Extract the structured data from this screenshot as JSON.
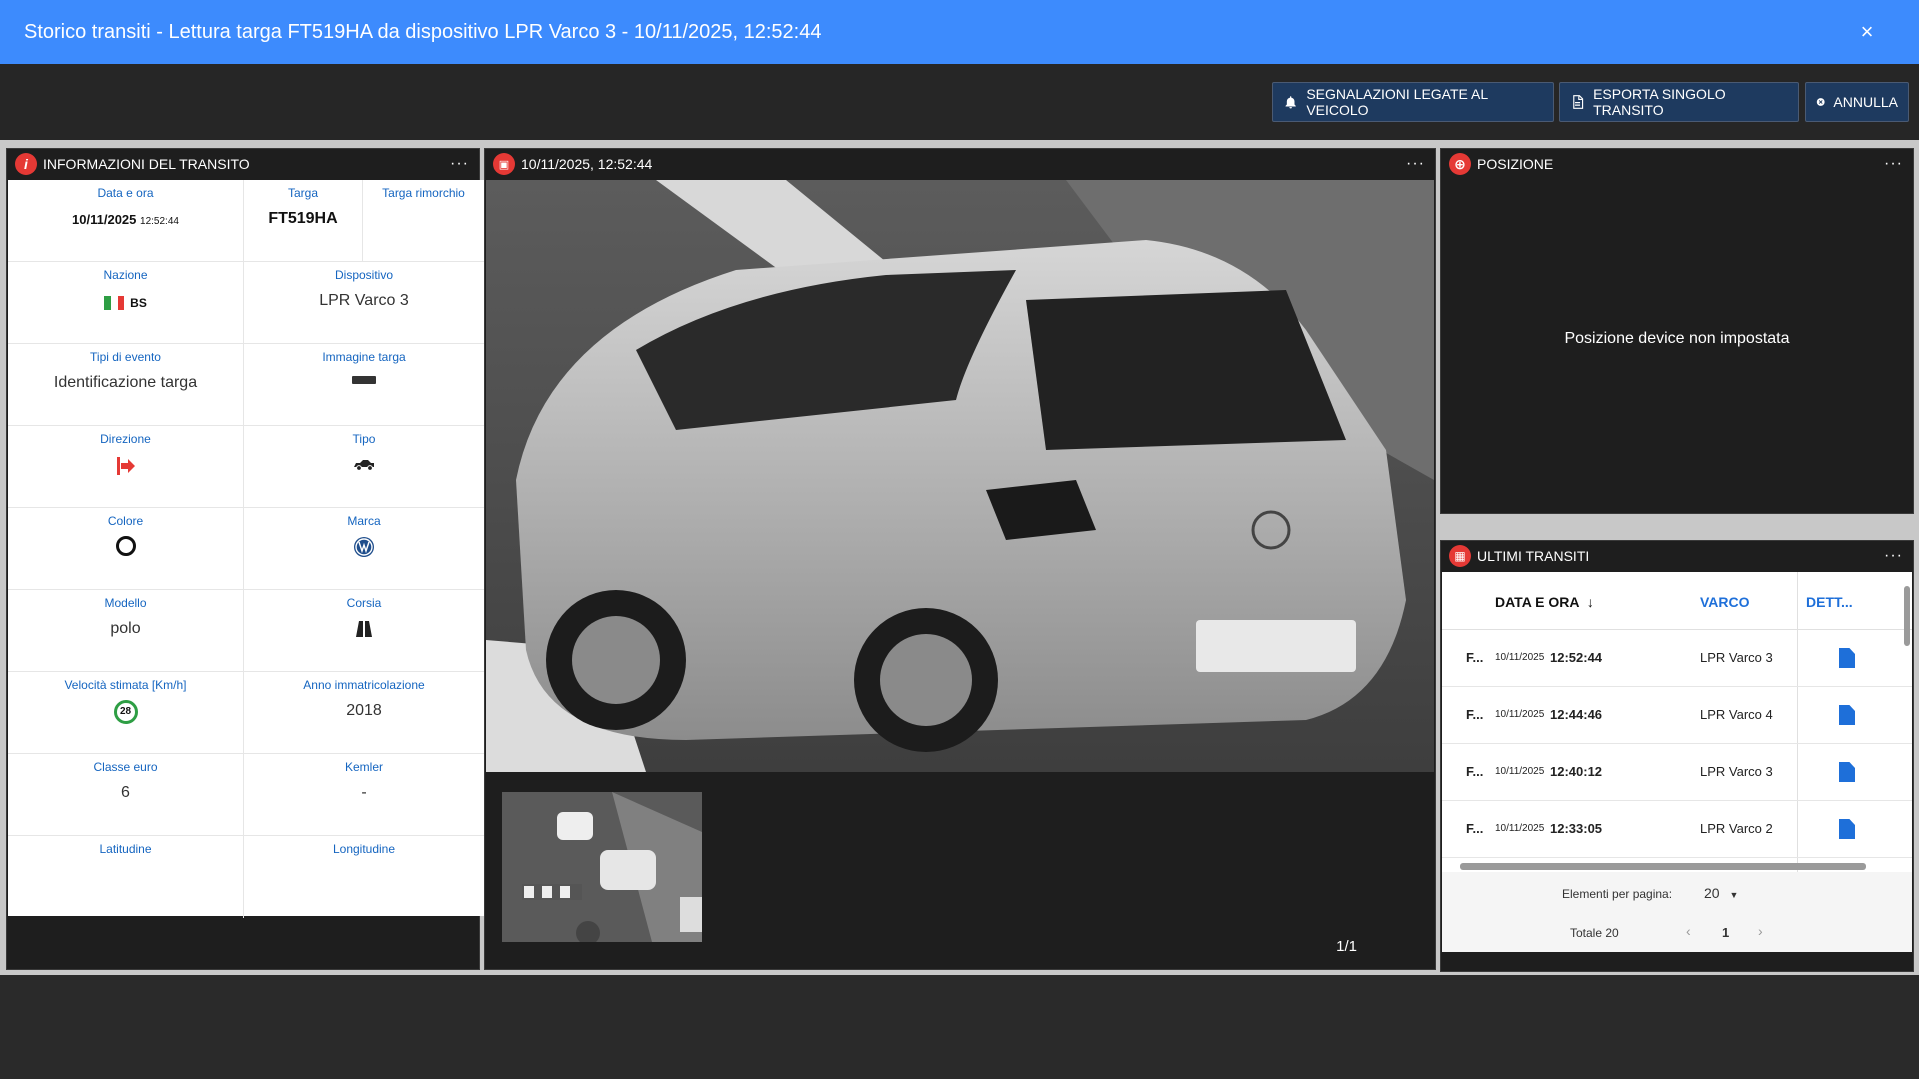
{
  "window": {
    "title": "Storico transiti - Lettura targa FT519HA da dispositivo LPR Varco 3 - 10/11/2025, 12:52:44",
    "close": "×"
  },
  "toolbar": {
    "alerts_label": "SEGNALAZIONI LEGATE AL VEICOLO",
    "export_label": "ESPORTA SINGOLO TRANSITO",
    "cancel_label": "ANNULLA"
  },
  "info_panel": {
    "title": "INFORMAZIONI DEL TRANSITO",
    "icon": "i",
    "menu": "···",
    "fields": {
      "date_label": "Data e ora",
      "date_value": "10/11/2025",
      "time_value": "12:52:44",
      "plate_label": "Targa",
      "plate_value": "FT519HA",
      "trailer_label": "Targa rimorchio",
      "nation_label": "Nazione",
      "nation_value": "BS",
      "device_label": "Dispositivo",
      "device_value": "LPR Varco 3",
      "event_label": "Tipi di evento",
      "event_value": "Identificazione targa",
      "plate_img_label": "Immagine targa",
      "direction_label": "Direzione",
      "type_label": "Tipo",
      "color_label": "Colore",
      "brand_label": "Marca",
      "model_label": "Modello",
      "model_value": "polo",
      "lane_label": "Corsia",
      "speed_label": "Velocità stimata [Km/h]",
      "speed_value": "28",
      "year_label": "Anno immatricolazione",
      "year_value": "2018",
      "euro_label": "Classe euro",
      "euro_value": "6",
      "kemler_label": "Kemler",
      "kemler_value": "-",
      "lat_label": "Latitudine",
      "lon_label": "Longitudine"
    }
  },
  "photo_panel": {
    "title": "10/11/2025, 12:52:44",
    "menu": "···",
    "counter": "1/1"
  },
  "position_panel": {
    "title": "POSIZIONE",
    "menu": "···",
    "message": "Posizione device non impostata"
  },
  "transits_panel": {
    "title": "ULTIMI TRANSITI",
    "menu": "···",
    "headers": {
      "date": "DATA E ORA",
      "gate": "VARCO",
      "detail": "DETT..."
    },
    "rows": [
      {
        "plate": "F...",
        "date": "10/11/2025",
        "time": "12:52:44",
        "gate": "LPR Varco 3"
      },
      {
        "plate": "F...",
        "date": "10/11/2025",
        "time": "12:44:46",
        "gate": "LPR Varco 4"
      },
      {
        "plate": "F...",
        "date": "10/11/2025",
        "time": "12:40:12",
        "gate": "LPR Varco 3"
      },
      {
        "plate": "F...",
        "date": "10/11/2025",
        "time": "12:33:05",
        "gate": "LPR Varco 2"
      }
    ],
    "footer": {
      "per_page_label": "Elementi per pagina:",
      "per_page_value": "20",
      "total": "Totale 20",
      "page": "1"
    }
  },
  "colors": {
    "title_bar": "#3d8bfd",
    "accent_blue": "#1565c0",
    "icon_red": "#e53935",
    "speed_green": "#2e9e44"
  }
}
